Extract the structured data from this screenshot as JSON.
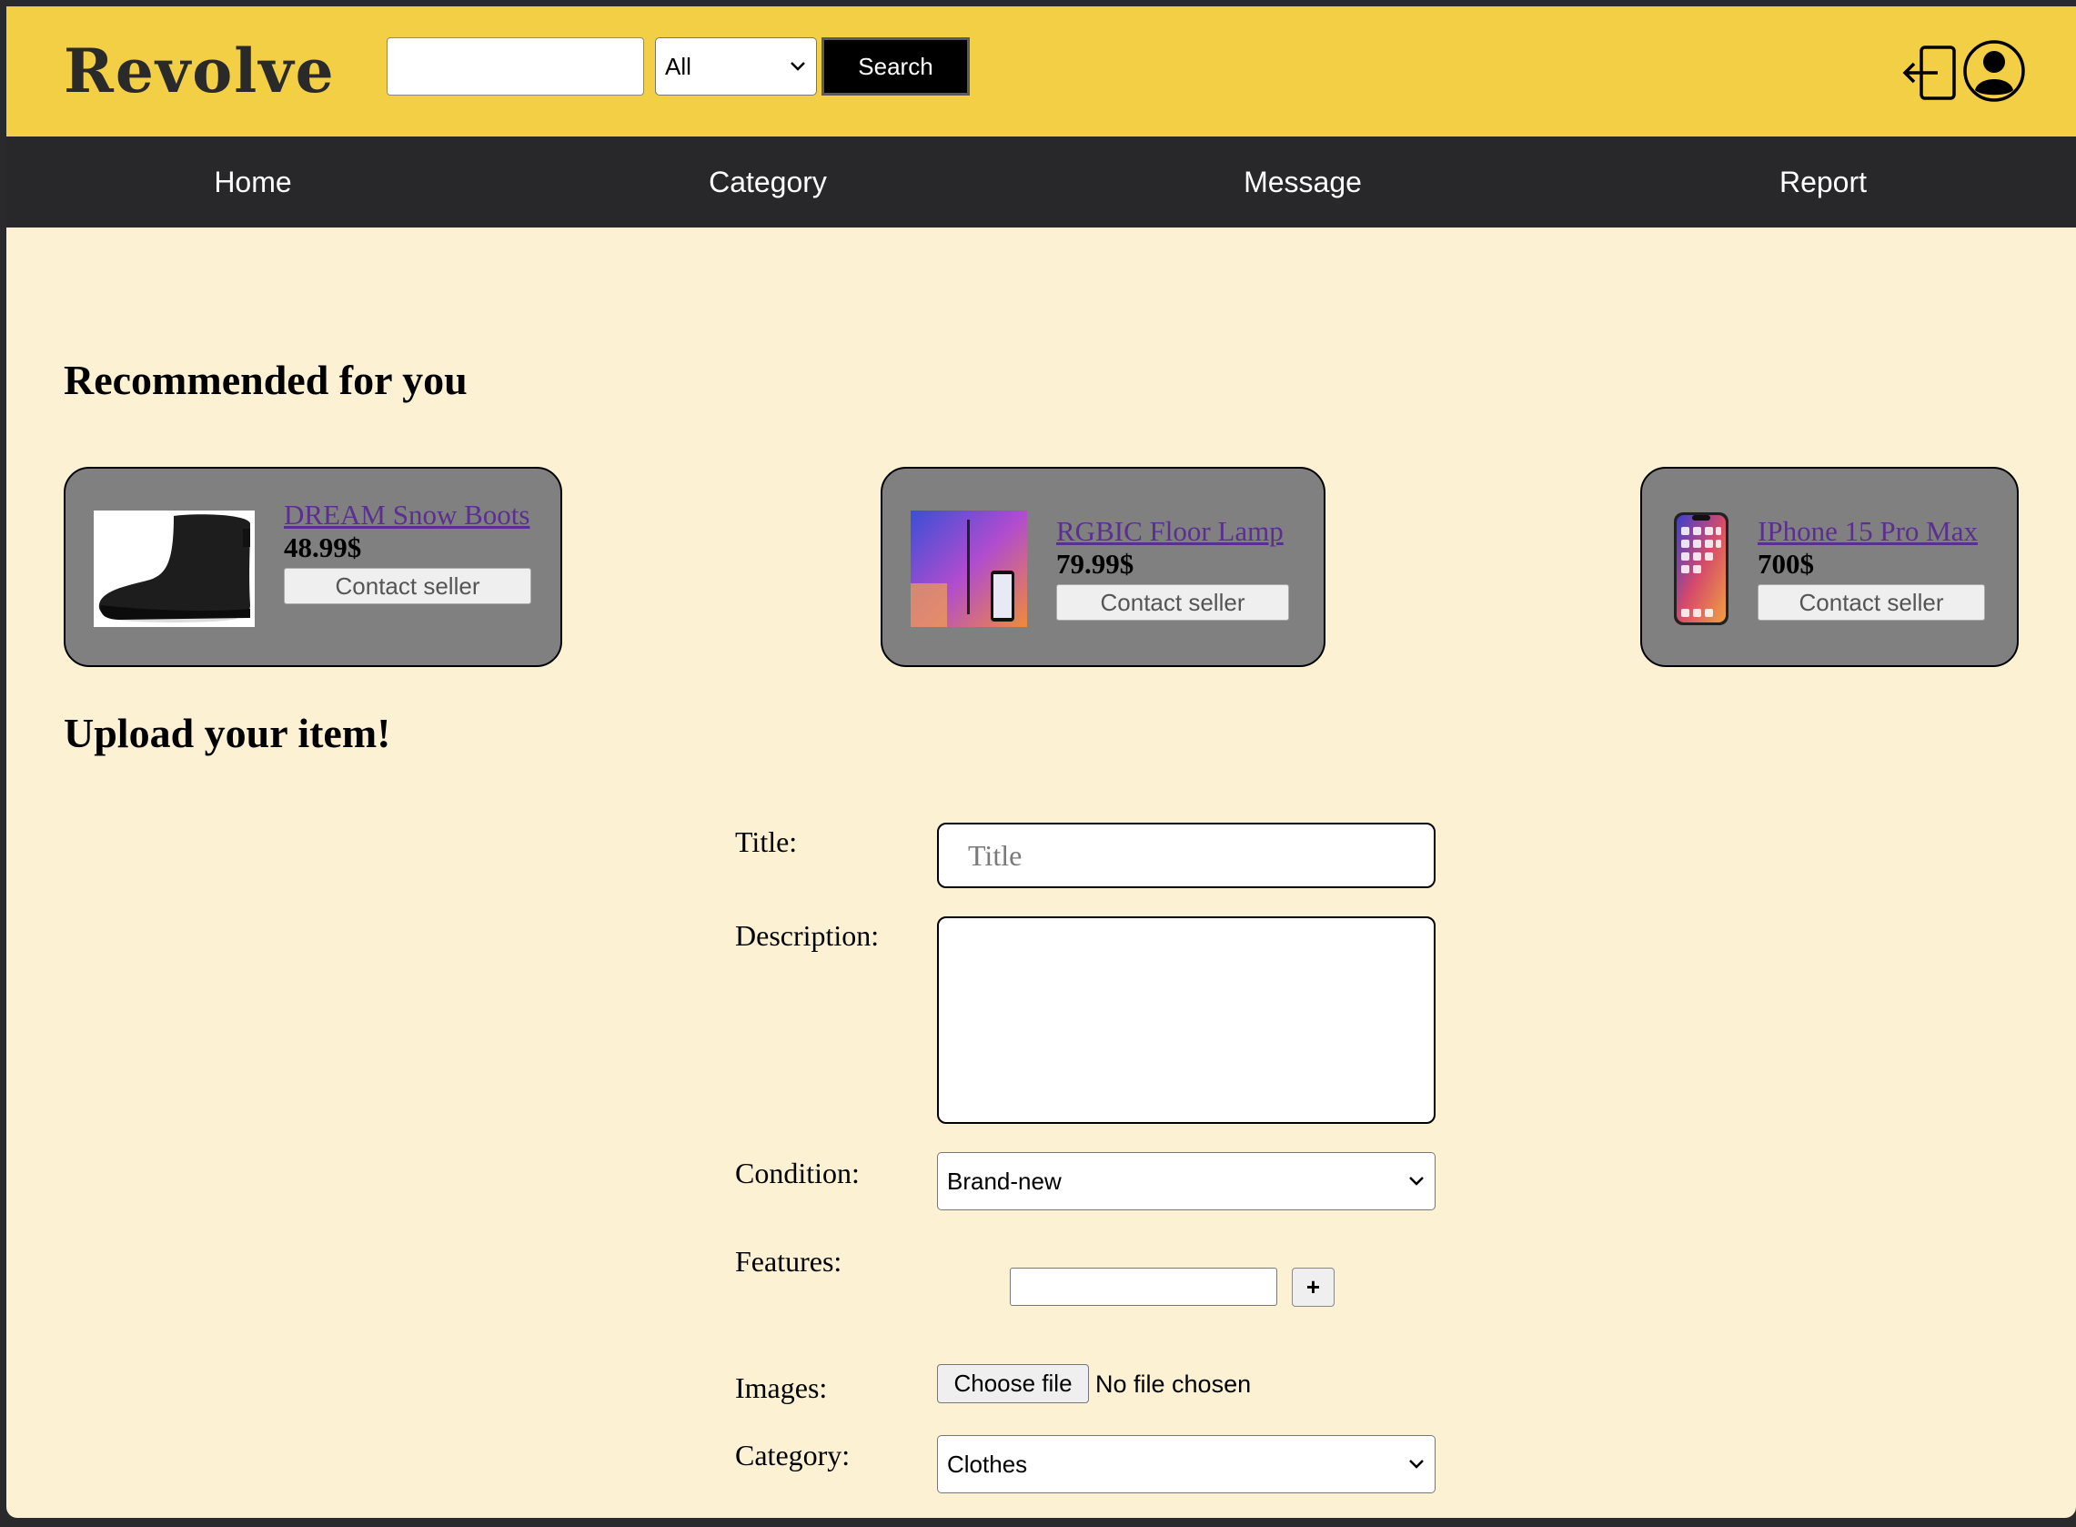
{
  "header": {
    "logo": "Revolve",
    "search_placeholder": "",
    "search_category": "All",
    "search_button": "Search"
  },
  "nav": {
    "items": [
      {
        "label": "Home"
      },
      {
        "label": "Category"
      },
      {
        "label": "Message"
      },
      {
        "label": "Report"
      }
    ]
  },
  "recommended": {
    "heading": "Recommended for you",
    "items": [
      {
        "title": "DREAM Snow Boots",
        "price": "48.99$",
        "button": "Contact seller",
        "image": "black-snow-boot"
      },
      {
        "title": "RGBIC Floor Lamp",
        "price": "79.99$",
        "button": "Contact seller",
        "image": "rgb-floor-lamp"
      },
      {
        "title": "IPhone 15 Pro Max",
        "price": "700$",
        "button": "Contact seller",
        "image": "smartphone"
      }
    ]
  },
  "upload": {
    "heading": "Upload your item!",
    "title_label": "Title:",
    "title_placeholder": "Title",
    "description_label": "Description:",
    "condition_label": "Condition:",
    "condition_value": "Brand-new",
    "features_label": "Features:",
    "add_feature_button": "+",
    "images_label": "Images:",
    "choose_file_button": "Choose file",
    "file_status": "No file chosen",
    "category_label": "Category:",
    "category_value": "Clothes"
  },
  "colors": {
    "header_bg": "#f3cf45",
    "nav_bg": "#28282a",
    "page_bg": "#fdf1d4",
    "card_bg": "#808080",
    "link": "#5a2f8f"
  }
}
